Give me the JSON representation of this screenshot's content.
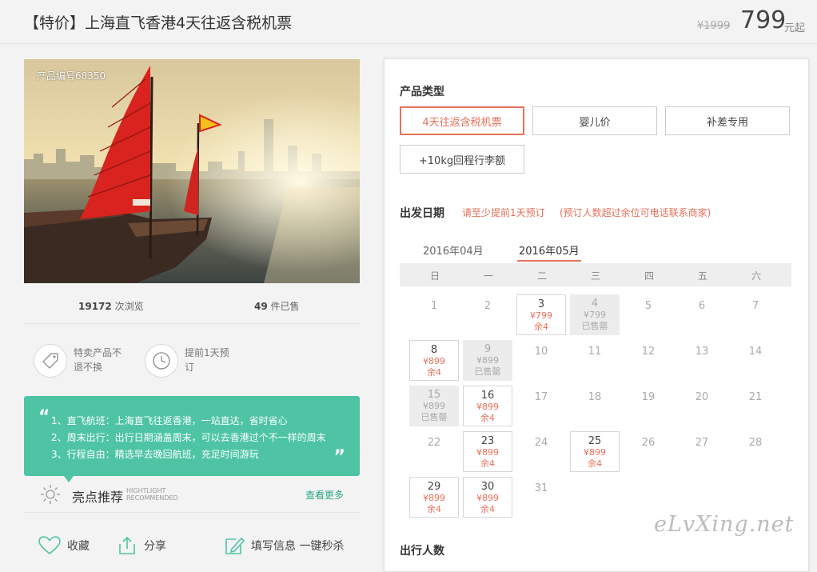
{
  "header": {
    "title": "【特价】上海直飞香港4天往返含税机票",
    "original_price": "¥1999",
    "price": "799",
    "price_unit": "元起"
  },
  "gallery": {
    "product_no": "产品编号68350"
  },
  "stats": {
    "views_count": "19172",
    "views_label": "次浏览",
    "sold_count": "49",
    "sold_label": "件已售"
  },
  "features": [
    {
      "icon": "tag-icon",
      "text": "特卖产品不退不换"
    },
    {
      "icon": "clock-icon",
      "text": "提前1天预订"
    }
  ],
  "highlights": {
    "lines": [
      "1、直飞航班：上海直飞往返香港，一站直达，省时省心",
      "2、周末出行：出行日期涵盖周末，可以去香港过个不一样的周末",
      "3、行程自由：精选早去晚回航班，充足时间游玩"
    ],
    "title": "亮点推荐",
    "title_en_1": "HIGHTLIGHT",
    "title_en_2": "RECOMMENDED",
    "more": "查看更多"
  },
  "actions": {
    "favorite": "收藏",
    "share": "分享",
    "fill_info": "填写信息 一键秒杀"
  },
  "booking": {
    "product_type_title": "产品类型",
    "types": [
      "4天往返含税机票",
      "婴儿价",
      "补差专用",
      "+10kg回程行李额"
    ],
    "selected_type": "4天往返含税机票",
    "departure_title": "出发日期",
    "note1": "请至少提前1天预订",
    "note2": "(预订人数超过余位可电话联系商家)",
    "months": [
      "2016年04月",
      "2016年05月"
    ],
    "active_month": "2016年05月",
    "weekdays": [
      "日",
      "一",
      "二",
      "三",
      "四",
      "五",
      "六"
    ],
    "days": [
      {
        "d": "1"
      },
      {
        "d": "2"
      },
      {
        "d": "3",
        "price": "¥799",
        "remain": "余4",
        "status": "available"
      },
      {
        "d": "4",
        "price": "¥799",
        "remain": "已售罄",
        "status": "sold"
      },
      {
        "d": "5"
      },
      {
        "d": "6"
      },
      {
        "d": "7"
      },
      {
        "d": "8",
        "price": "¥899",
        "remain": "余4",
        "status": "available"
      },
      {
        "d": "9",
        "price": "¥899",
        "remain": "已售罄",
        "status": "sold"
      },
      {
        "d": "10"
      },
      {
        "d": "11"
      },
      {
        "d": "12"
      },
      {
        "d": "13"
      },
      {
        "d": "14"
      },
      {
        "d": "15",
        "price": "¥899",
        "remain": "已售罄",
        "status": "sold"
      },
      {
        "d": "16",
        "price": "¥899",
        "remain": "余4",
        "status": "available"
      },
      {
        "d": "17"
      },
      {
        "d": "18"
      },
      {
        "d": "19"
      },
      {
        "d": "20"
      },
      {
        "d": "21"
      },
      {
        "d": "22"
      },
      {
        "d": "23",
        "price": "¥899",
        "remain": "余4",
        "status": "available"
      },
      {
        "d": "24"
      },
      {
        "d": "25",
        "price": "¥899",
        "remain": "余4",
        "status": "available"
      },
      {
        "d": "26"
      },
      {
        "d": "27"
      },
      {
        "d": "28"
      },
      {
        "d": "29",
        "price": "¥899",
        "remain": "余4",
        "status": "available"
      },
      {
        "d": "30",
        "price": "¥899",
        "remain": "余4",
        "status": "available"
      },
      {
        "d": "31"
      }
    ],
    "people_title": "出行人数"
  },
  "watermark": "eLvXing.net",
  "colors": {
    "accent": "#e8705a",
    "highlight_bg": "#4ec4a5",
    "link": "#2aa884"
  }
}
